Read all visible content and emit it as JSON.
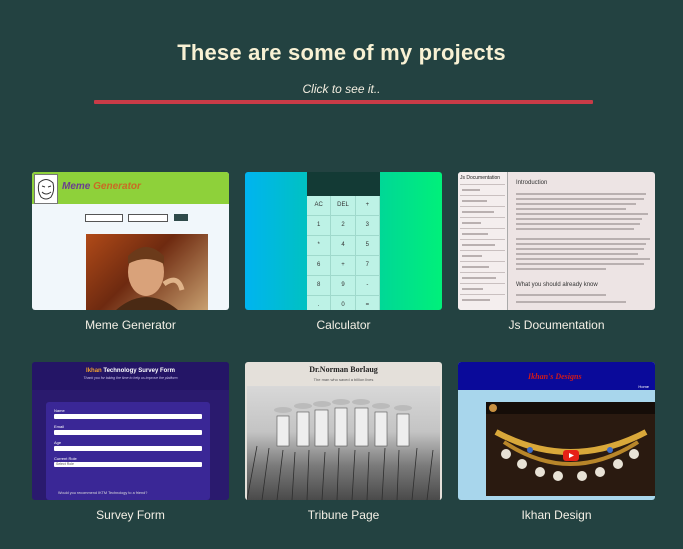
{
  "header": {
    "title": "These are some of my projects",
    "subtitle": "Click to see it.."
  },
  "projects": [
    {
      "caption": "Meme Generator",
      "thumb": {
        "brand_word1": "Meme",
        "brand_word2": "Generator"
      }
    },
    {
      "caption": "Calculator",
      "thumb": {
        "keys": [
          "AC",
          "DEL",
          "+",
          "1",
          "2",
          "3",
          "*",
          "4",
          "5",
          "6",
          "+",
          "7",
          "8",
          "9",
          "-",
          ".",
          "0",
          "="
        ]
      }
    },
    {
      "caption": "Js Documentation",
      "thumb": {
        "sidebar_title": "Js Documentation",
        "heading": "Introduction",
        "subheading": "What you should already know"
      }
    },
    {
      "caption": "Survey Form",
      "thumb": {
        "form_title_accent": "Ikhan",
        "form_title_rest": "Technology Survey Form",
        "form_tagline": "Thank you for taking the time to help us improve the platform",
        "field_labels": [
          "Name",
          "Email",
          "Age",
          "Current Role"
        ],
        "role_value": "Select Role",
        "question": "Would you recommend IKTM Technology to a friend?"
      }
    },
    {
      "caption": "Tribune Page",
      "thumb": {
        "heading": "Dr.Norman Borlaug",
        "tagline": "The man who saved a billion lives"
      }
    },
    {
      "caption": "Ikhan Design",
      "thumb": {
        "logo_text": "Ikhan's Designs",
        "nav_item": "Home"
      }
    }
  ],
  "colors": {
    "background": "#234241",
    "rule": "#c93b47",
    "title": "#f8f1d4"
  }
}
